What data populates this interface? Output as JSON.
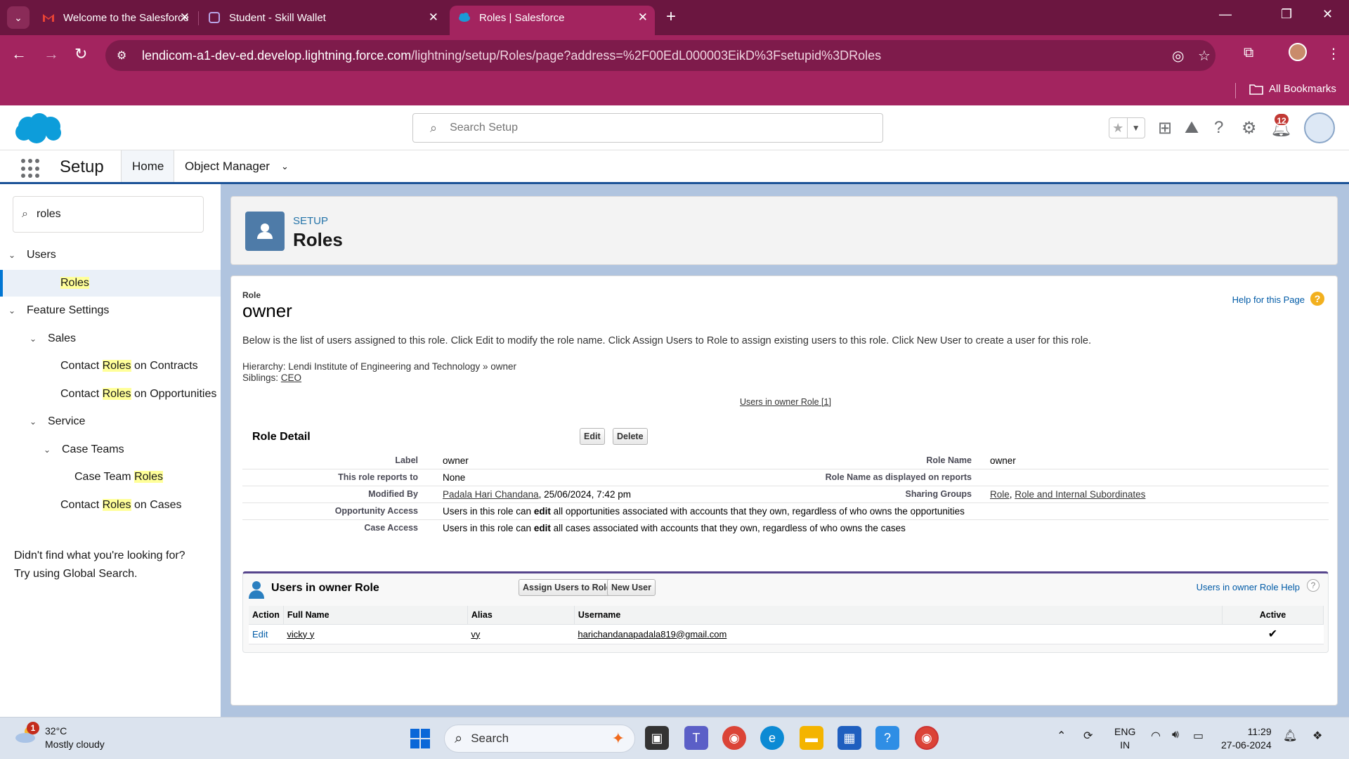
{
  "browser": {
    "tabs": [
      {
        "title": "Welcome to the Salesforce Virtu",
        "active": false
      },
      {
        "title": "Student - Skill Wallet",
        "active": false
      },
      {
        "title": "Roles | Salesforce",
        "active": true
      }
    ],
    "url_host": "lendicom-a1-dev-ed.develop.lightning.force.com",
    "url_path": "/lightning/setup/Roles/page?address=%2F00EdL000003EikD%3Fsetupid%3DRoles",
    "bookmarks_label": "All Bookmarks"
  },
  "sf_header": {
    "search_placeholder": "Search Setup",
    "notification_count": "12"
  },
  "sf_nav": {
    "app_name": "Setup",
    "tabs": [
      {
        "label": "Home",
        "active": true
      },
      {
        "label": "Object Manager",
        "active": false
      }
    ]
  },
  "left_panel": {
    "quick_find_value": "roles",
    "tree": [
      {
        "pre": "",
        "hl": "",
        "post": "Users",
        "level": 0,
        "expanded": true
      },
      {
        "pre": "",
        "hl": "Roles",
        "post": "",
        "level": 2,
        "selected": true
      },
      {
        "pre": "",
        "hl": "",
        "post": "Feature Settings",
        "level": 0,
        "expanded": true
      },
      {
        "pre": "",
        "hl": "",
        "post": "Sales",
        "level": 1,
        "expanded": true
      },
      {
        "pre": "Contact ",
        "hl": "Roles",
        "post": " on Contracts",
        "level": 3
      },
      {
        "pre": "Contact ",
        "hl": "Roles",
        "post": " on Opportunities",
        "level": 3
      },
      {
        "pre": "",
        "hl": "",
        "post": "Service",
        "level": 1,
        "expanded": true
      },
      {
        "pre": "",
        "hl": "",
        "post": "Case Teams",
        "level": 2,
        "expanded": true
      },
      {
        "pre": "Case Team ",
        "hl": "Roles",
        "post": "",
        "level": 4
      },
      {
        "pre": "Contact ",
        "hl": "Roles",
        "post": " on Cases",
        "level": 3
      }
    ],
    "help_line1": "Didn't find what you're looking for?",
    "help_line2": "Try using Global Search."
  },
  "page_header": {
    "eyebrow": "SETUP",
    "title": "Roles"
  },
  "role_page": {
    "eyebrow": "Role",
    "title": "owner",
    "help_link": "Help for this Page",
    "intro": "Below is the list of users assigned to this role. Click Edit to modify the role name. Click Assign Users to Role to assign existing users to this role. Click New User to create a user for this role.",
    "hierarchy_label": "Hierarchy:",
    "hierarchy_value": "Lendi Institute of Engineering and Technology » owner",
    "siblings_label": "Siblings:",
    "siblings_value": "CEO",
    "users_link": "Users in owner Role",
    "users_link_count": "[1]"
  },
  "role_detail": {
    "title": "Role Detail",
    "edit_label": "Edit",
    "delete_label": "Delete",
    "label_label": "Label",
    "label_value": "owner",
    "role_name_label": "Role Name",
    "role_name_value": "owner",
    "reports_to_label": "This role reports to",
    "reports_to_value": "None",
    "role_name_reports_label": "Role Name as displayed on reports",
    "modified_by_label": "Modified By",
    "modified_by_name": "Padala Hari Chandana",
    "modified_by_date": ", 25/06/2024, 7:42 pm",
    "sharing_groups_label": "Sharing Groups",
    "sharing_group_1": "Role",
    "sharing_group_2": "Role and Internal Subordinates",
    "opp_access_label": "Opportunity Access",
    "opp_access_pre": "Users in this role can ",
    "opp_access_bold": "edit",
    "opp_access_post": " all opportunities associated with accounts that they own, regardless of who owns the opportunities",
    "case_access_label": "Case Access",
    "case_access_pre": "Users in this role can ",
    "case_access_bold": "edit",
    "case_access_post": " all cases associated with accounts that they own, regardless of who owns the cases"
  },
  "users_list": {
    "title": "Users in owner Role",
    "assign_label": "Assign Users to Role",
    "new_user_label": "New User",
    "help_link": "Users in owner Role Help",
    "columns": [
      "Action",
      "Full Name",
      "Alias",
      "Username",
      "Active"
    ],
    "rows": [
      {
        "action": "Edit",
        "full_name": "vicky y",
        "alias": "vy",
        "username": "harichandanapadala819@gmail.com",
        "active": "✔"
      }
    ]
  },
  "taskbar": {
    "temperature": "32°C",
    "weather": "Mostly cloudy",
    "weather_badge": "1",
    "search_label": "Search",
    "lang_1": "ENG",
    "lang_2": "IN",
    "time": "11:29",
    "date": "27-06-2024"
  },
  "colors": {
    "browser_frame": "#a3245f",
    "salesforce_blue": "#0176d3",
    "highlight": "#ffff99",
    "related_list_border": "#56458c"
  }
}
